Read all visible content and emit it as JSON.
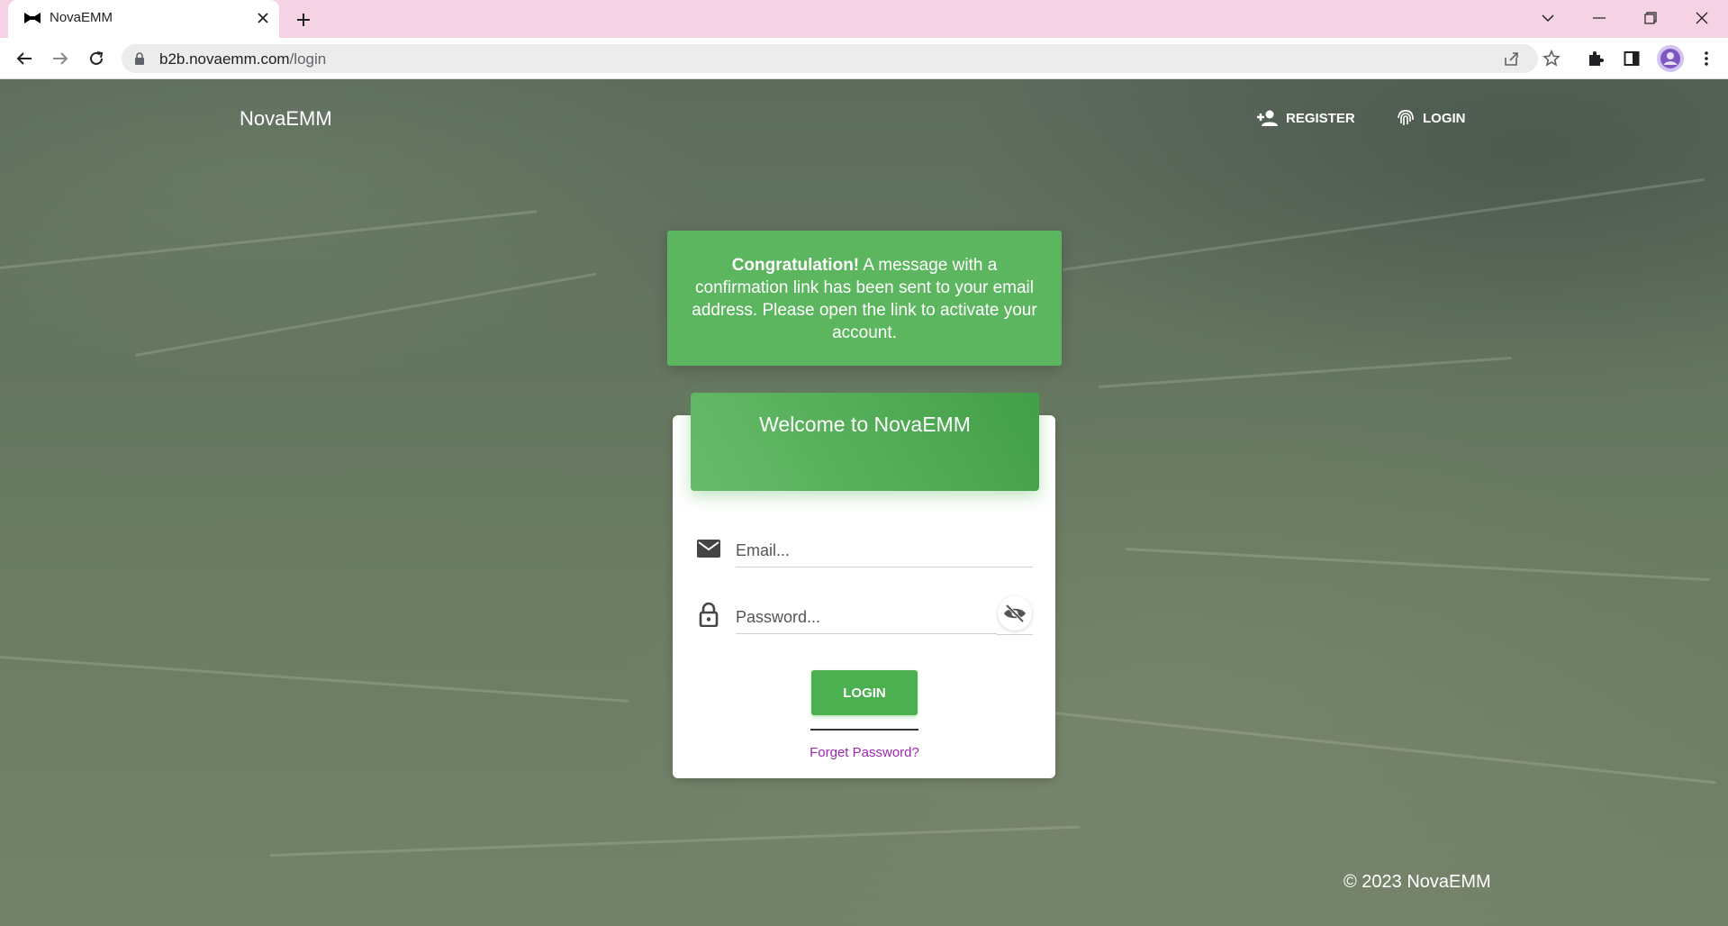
{
  "browser": {
    "tab_title": "NovaEMM",
    "url_host": "b2b.novaemm.com",
    "url_path": "/login"
  },
  "site": {
    "brand": "NovaEMM",
    "nav": {
      "register_label": "REGISTER",
      "login_label": "LOGIN"
    }
  },
  "alert": {
    "strong": "Congratulation!",
    "message": " A message with a confirmation link has been sent to your email address. Please open the link to activate your account."
  },
  "login_card": {
    "title": "Welcome to NovaEMM",
    "email_placeholder": "Email...",
    "password_placeholder": "Password...",
    "login_button": "LOGIN",
    "forget_link": "Forget Password?"
  },
  "footer": {
    "copyright": "© 2023 NovaEMM"
  },
  "colors": {
    "tabstrip": "#f6d3e4",
    "accent_green": "#4caf50",
    "alert_green": "#5cb65f",
    "link_purple": "#9c27b0"
  }
}
